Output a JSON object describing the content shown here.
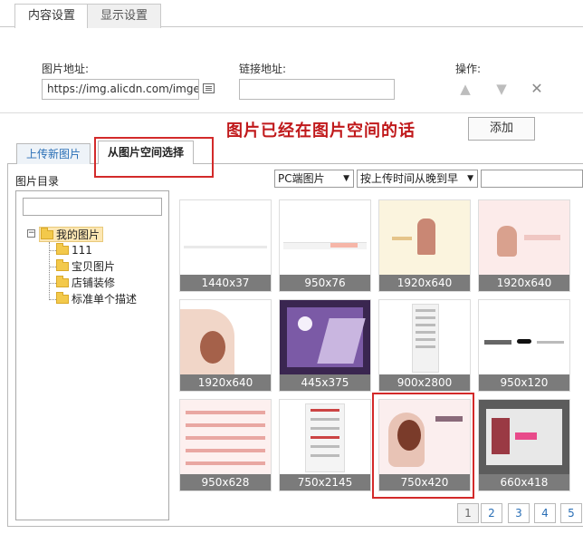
{
  "tabs": {
    "content": "内容设置",
    "display": "显示设置"
  },
  "form": {
    "image_url_label": "图片地址:",
    "image_url_value": "https://img.alicdn.com/imgextra",
    "link_url_label": "链接地址:",
    "link_url_value": "",
    "operations_label": "操作:"
  },
  "annotation": "图片已经在图片空间的话",
  "add_button": "添加",
  "sub_tabs": {
    "upload": "上传新图片",
    "from_space": "从图片空间选择"
  },
  "directory": {
    "title": "图片目录",
    "root": "我的图片",
    "folders": [
      "111",
      "宝贝图片",
      "店铺装修",
      "标准单个描述"
    ]
  },
  "filters": {
    "platform": "PC端图片",
    "sort": "按上传时间从晚到早"
  },
  "thumbnails": [
    {
      "size": "1440x37"
    },
    {
      "size": "950x76"
    },
    {
      "size": "1920x640"
    },
    {
      "size": "1920x640"
    },
    {
      "size": "1920x640"
    },
    {
      "size": "445x375"
    },
    {
      "size": "900x2800"
    },
    {
      "size": "950x120"
    },
    {
      "size": "950x628"
    },
    {
      "size": "750x2145"
    },
    {
      "size": "750x420"
    },
    {
      "size": "660x418"
    }
  ],
  "pagination": {
    "pages": [
      "1",
      "2",
      "3",
      "4",
      "5"
    ],
    "current": "1"
  },
  "colors": {
    "annotation_red": "#c0191b",
    "caption_bg": "#7b7b7b",
    "link_blue": "#2a6fb6"
  }
}
